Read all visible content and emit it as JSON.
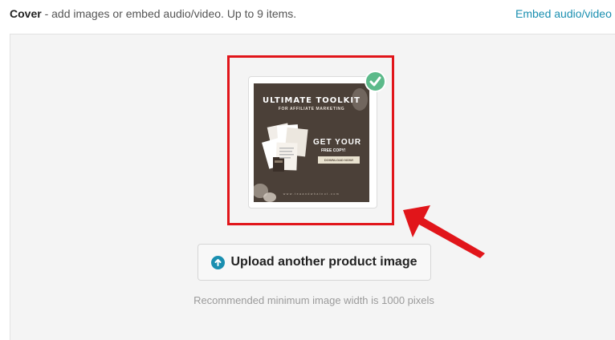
{
  "header": {
    "label": "Cover",
    "description": " - add images or embed audio/video. Up to 9 items.",
    "embed_link": "Embed audio/video"
  },
  "thumbnail": {
    "title": "ULTIMATE TOOLKIT",
    "subtitle": "FOR AFFILIATE MARKETING",
    "cta": "GET YOUR",
    "cta_sub": "FREE COPY!",
    "button": "DOWNLOAD NOW!",
    "url": "www.teaandwhatnot.com",
    "selected": true
  },
  "upload": {
    "label": "Upload another product image",
    "icon": "upload-arrow-icon"
  },
  "hint": "Recommended minimum image width is 1000 pixels",
  "colors": {
    "accent": "#1a8fb0",
    "highlight": "#e1151a",
    "check": "#5cba8a",
    "thumb_bg": "#4b4038"
  }
}
